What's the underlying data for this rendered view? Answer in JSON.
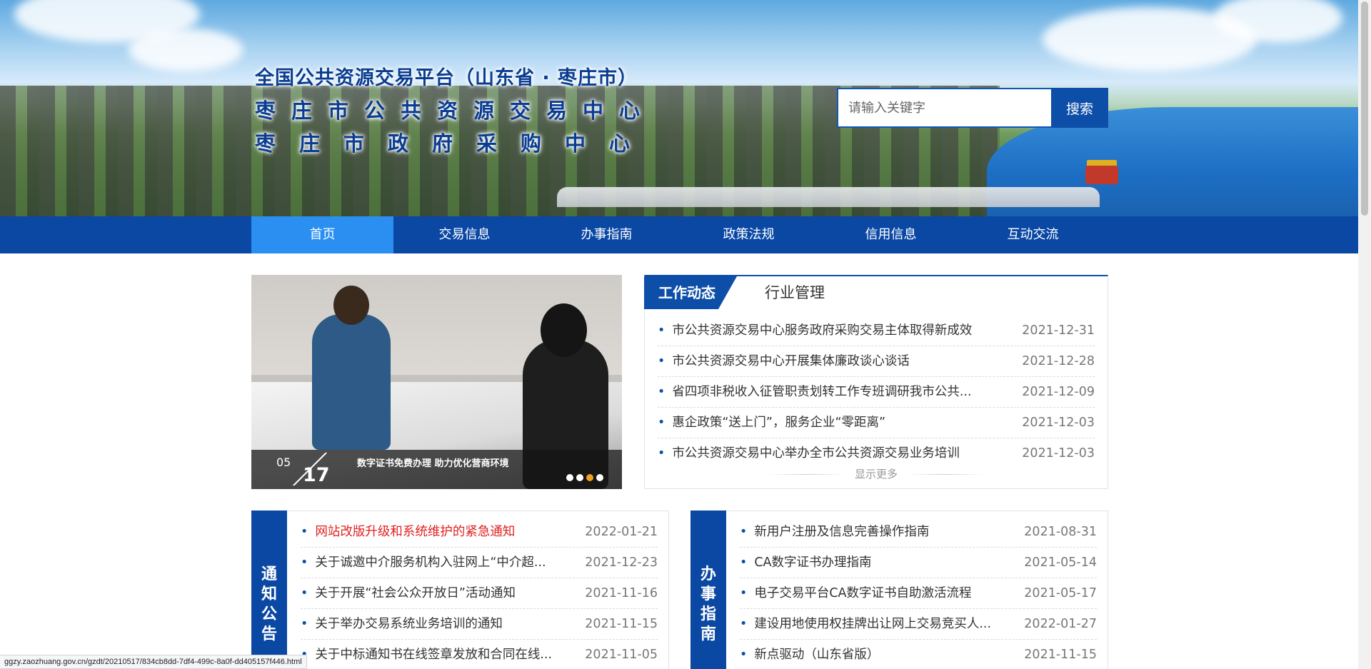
{
  "header": {
    "title_line1": "全国公共资源交易平台（山东省 · 枣庄市）",
    "title_line2": "枣庄市公共资源交易中心",
    "title_line3": "枣庄市政府采购中心"
  },
  "search": {
    "placeholder": "请输入关键字",
    "button_label": "搜索"
  },
  "nav": {
    "items": [
      {
        "label": "首页"
      },
      {
        "label": "交易信息"
      },
      {
        "label": "办事指南"
      },
      {
        "label": "政策法规"
      },
      {
        "label": "信用信息"
      },
      {
        "label": "互动交流"
      }
    ]
  },
  "slider": {
    "month": "05",
    "day": "17",
    "caption": "数字证书免费办理 助力优化营商环境",
    "active_dot": 3,
    "dot_count": 4
  },
  "news": {
    "tab_active": "工作动态",
    "tab_other": "行业管理",
    "items": [
      {
        "title": "市公共资源交易中心服务政府采购交易主体取得新成效",
        "date": "2021-12-31"
      },
      {
        "title": "市公共资源交易中心开展集体廉政谈心谈话",
        "date": "2021-12-28"
      },
      {
        "title": "省四项非税收入征管职责划转工作专班调研我市公共...",
        "date": "2021-12-09"
      },
      {
        "title": "惠企政策“送上门”，服务企业“零距离”",
        "date": "2021-12-03"
      },
      {
        "title": "市公共资源交易中心举办全市公共资源交易业务培训",
        "date": "2021-12-03"
      }
    ],
    "more_label": "显示更多"
  },
  "notices": {
    "side_label": [
      "通",
      "知",
      "公",
      "告"
    ],
    "items": [
      {
        "title": "网站改版升级和系统维护的紧急通知",
        "date": "2022-01-21"
      },
      {
        "title": "关于诚邀中介服务机构入驻网上“中介超...",
        "date": "2021-12-23"
      },
      {
        "title": "关于开展“社会公众开放日”活动通知",
        "date": "2021-11-16"
      },
      {
        "title": "关于举办交易系统业务培训的通知",
        "date": "2021-11-15"
      },
      {
        "title": "关于中标通知书在线签章发放和合同在线...",
        "date": "2021-11-05"
      }
    ]
  },
  "guides": {
    "side_label": [
      "办",
      "事",
      "指",
      "南"
    ],
    "items": [
      {
        "title": "新用户注册及信息完善操作指南",
        "date": "2021-08-31"
      },
      {
        "title": "CA数字证书办理指南",
        "date": "2021-05-14"
      },
      {
        "title": "电子交易平台CA数字证书自助激活流程",
        "date": "2021-05-17"
      },
      {
        "title": "建设用地使用权挂牌出让网上交易竞买人...",
        "date": "2022-01-27"
      },
      {
        "title": "新点驱动（山东省版）",
        "date": "2021-11-15"
      }
    ]
  },
  "status_bar": {
    "url": "ggzy.zaozhuang.gov.cn/gzdt/20210517/834cb8dd-7df4-499c-8a0f-dd405157f446.html"
  },
  "colors": {
    "primary": "#0a48a4",
    "nav_active": "#2a8ff0",
    "urgent": "#e02020"
  }
}
